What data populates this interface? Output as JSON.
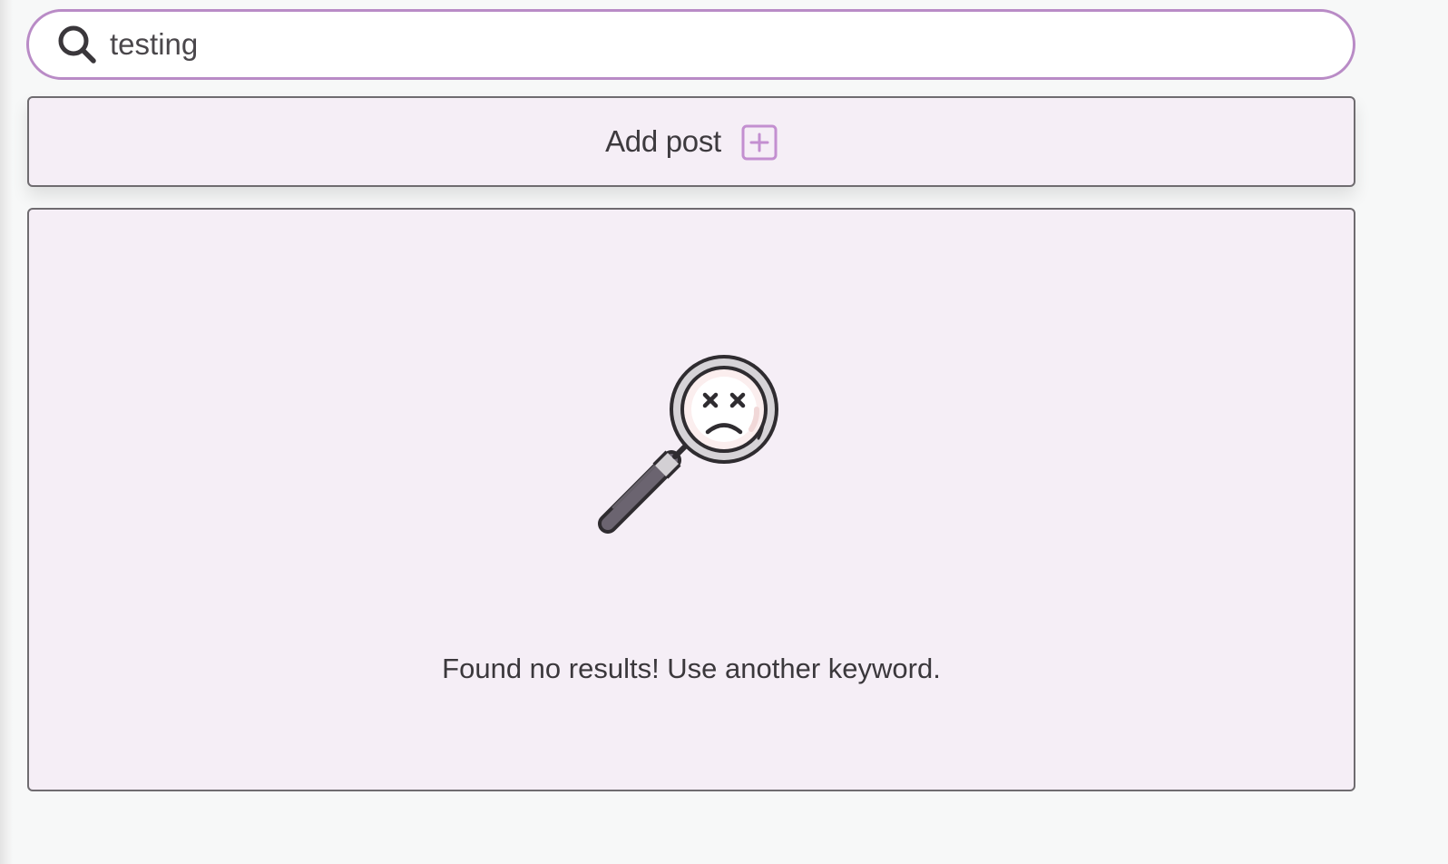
{
  "search": {
    "value": "testing",
    "icon": "search-icon"
  },
  "add_post": {
    "label": "Add post",
    "icon": "plus-square-icon"
  },
  "results": {
    "empty_icon": "no-results-magnifier-icon",
    "message": "Found no results! Use another keyword."
  },
  "colors": {
    "accent": "#b98bc6",
    "panel_background": "#f5eef6",
    "page_background": "#f7f8f8",
    "text": "#3b383c",
    "border": "#6f6c70"
  }
}
